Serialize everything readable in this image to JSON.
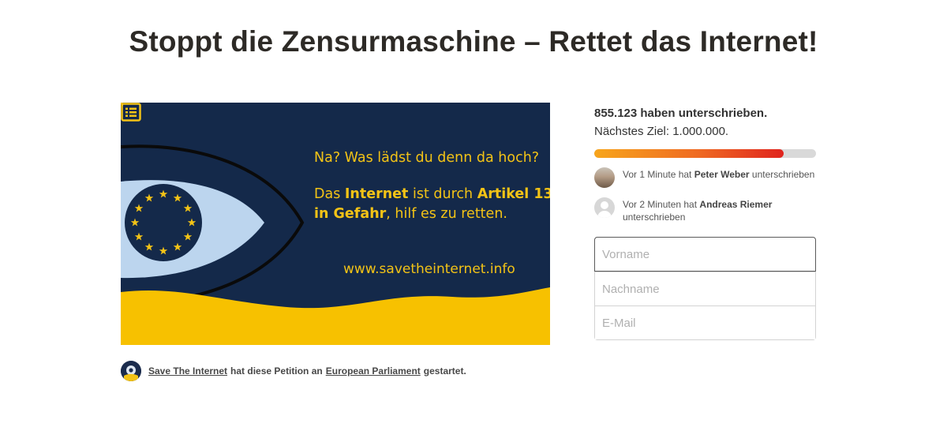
{
  "page": {
    "title": "Stoppt die Zensurmaschine – Rettet das Internet!"
  },
  "hero": {
    "line1": "Na? Was lädst du denn da hoch?",
    "line2_part1": "Das ",
    "line2_bold1": "Internet",
    "line2_part2": " ist durch ",
    "line2_bold2": "Artikel 13",
    "line3_bold": "in Gefahr",
    "line3_part": ", hilf es zu retten.",
    "url": "www.savetheinternet.info",
    "colors": {
      "background": "#14294a",
      "accent": "#f3c316",
      "eye": "#bcd5ee"
    }
  },
  "starter": {
    "avatar_icon": "savetheinternet-logo-icon",
    "creator": "Save The Internet",
    "text_middle": "hat diese Petition an",
    "target": "European Parliament",
    "text_end": "gestartet."
  },
  "progress": {
    "count_text": "855.123 haben unterschrieben.",
    "goal_text": " Nächstes Ziel: 1.000.000.",
    "signatures": 855123,
    "goal": 1000000
  },
  "recent_signers": [
    {
      "time_text": "Vor 1 Minute hat",
      "name": "Peter Weber",
      "action": "unterschrieben",
      "avatar": "photo-avatar"
    },
    {
      "time_text": "Vor 2 Minuten hat",
      "name": "Andreas Riemer",
      "action": "unterschrieben",
      "avatar": "default-avatar-icon"
    }
  ],
  "form": {
    "first_name_placeholder": "Vorname",
    "last_name_placeholder": "Nachname",
    "email_placeholder": "E-Mail"
  }
}
